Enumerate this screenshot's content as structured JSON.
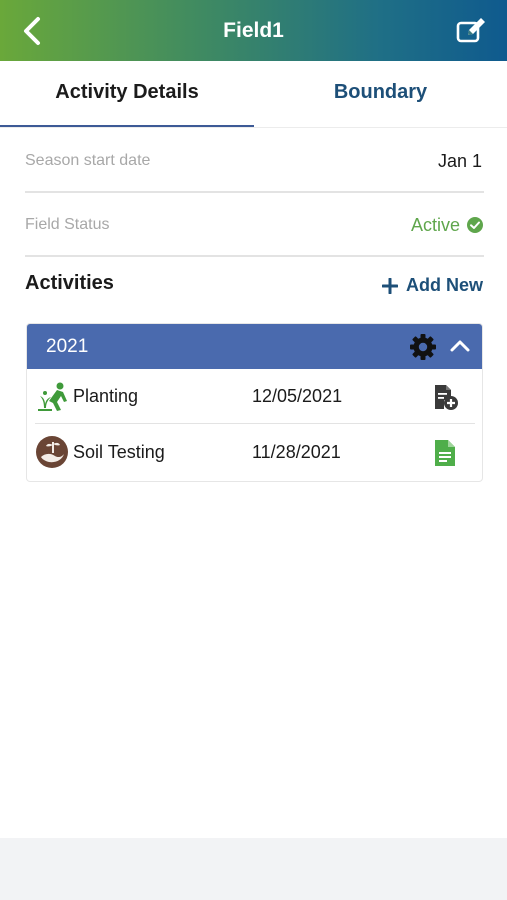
{
  "header": {
    "title": "Field1",
    "back_icon": "chevron-left-icon",
    "edit_icon": "edit-icon"
  },
  "tabs": [
    {
      "label": "Activity Details",
      "active": true
    },
    {
      "label": "Boundary",
      "active": false
    }
  ],
  "details": {
    "season_label": "Season start date",
    "season_value": "Jan 1",
    "status_label": "Field Status",
    "status_value": "Active"
  },
  "activities": {
    "title": "Activities",
    "add_label": "Add New",
    "groups": [
      {
        "year": "2021",
        "items": [
          {
            "name": "Planting",
            "date": "12/05/2021",
            "icon": "planting-icon",
            "doc_icon": "add-document-icon"
          },
          {
            "name": "Soil Testing",
            "date": "11/28/2021",
            "icon": "soil-testing-icon",
            "doc_icon": "document-icon"
          }
        ]
      }
    ]
  },
  "colors": {
    "header_gradient_start": "#6aa83a",
    "header_gradient_end": "#0f5a8e",
    "card_header": "#4a6aae",
    "active_green": "#5fa64c",
    "link_blue": "#1d4f78"
  }
}
